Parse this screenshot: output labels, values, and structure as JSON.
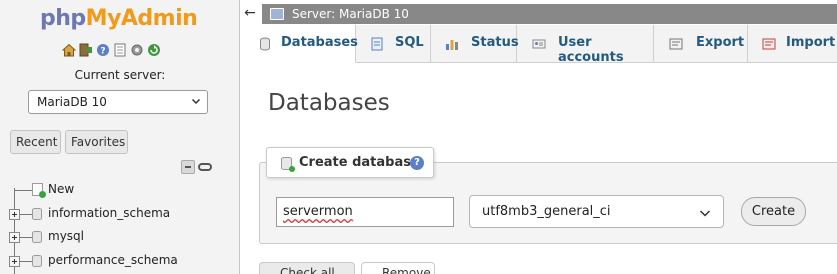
{
  "nav": {
    "logo_part1": "php",
    "logo_part2": "MyAdmin",
    "icons": [
      "home-icon",
      "logout-icon",
      "help-icon",
      "docs-icon",
      "settings-icon",
      "reload-icon"
    ],
    "current_server_label": "Current server:",
    "server_select_value": "MariaDB 10",
    "recent_label": "Recent",
    "favorites_label": "Favorites",
    "tree": [
      {
        "label": "New",
        "kind": "new"
      },
      {
        "label": "information_schema",
        "kind": "db"
      },
      {
        "label": "mysql",
        "kind": "db"
      },
      {
        "label": "performance_schema",
        "kind": "db"
      }
    ]
  },
  "topbar": {
    "collapse_glyph": "←",
    "title": "Server: MariaDB 10"
  },
  "tabs": [
    {
      "label": "Databases",
      "icon": "database-icon",
      "active": true
    },
    {
      "label": "SQL",
      "icon": "sql-icon",
      "active": false
    },
    {
      "label": "Status",
      "icon": "status-icon",
      "active": false
    },
    {
      "label": "User accounts",
      "icon": "user-accounts-icon",
      "active": false
    },
    {
      "label": "Export",
      "icon": "export-icon",
      "active": false
    },
    {
      "label": "Import",
      "icon": "import-icon",
      "active": false
    }
  ],
  "main": {
    "page_title": "Databases",
    "create": {
      "legend": "Create database",
      "help_glyph": "?",
      "db_name_value": "servermon",
      "collation_value": "utf8mb3_general_ci",
      "create_button": "Create"
    },
    "bottom_tabs": [
      "Check all",
      "Remove"
    ]
  },
  "colors": {
    "logo_php": "#6c78af",
    "logo_myadmin": "#f29a1a",
    "tab_text": "#235a81",
    "topbar_bg": "#888888"
  }
}
